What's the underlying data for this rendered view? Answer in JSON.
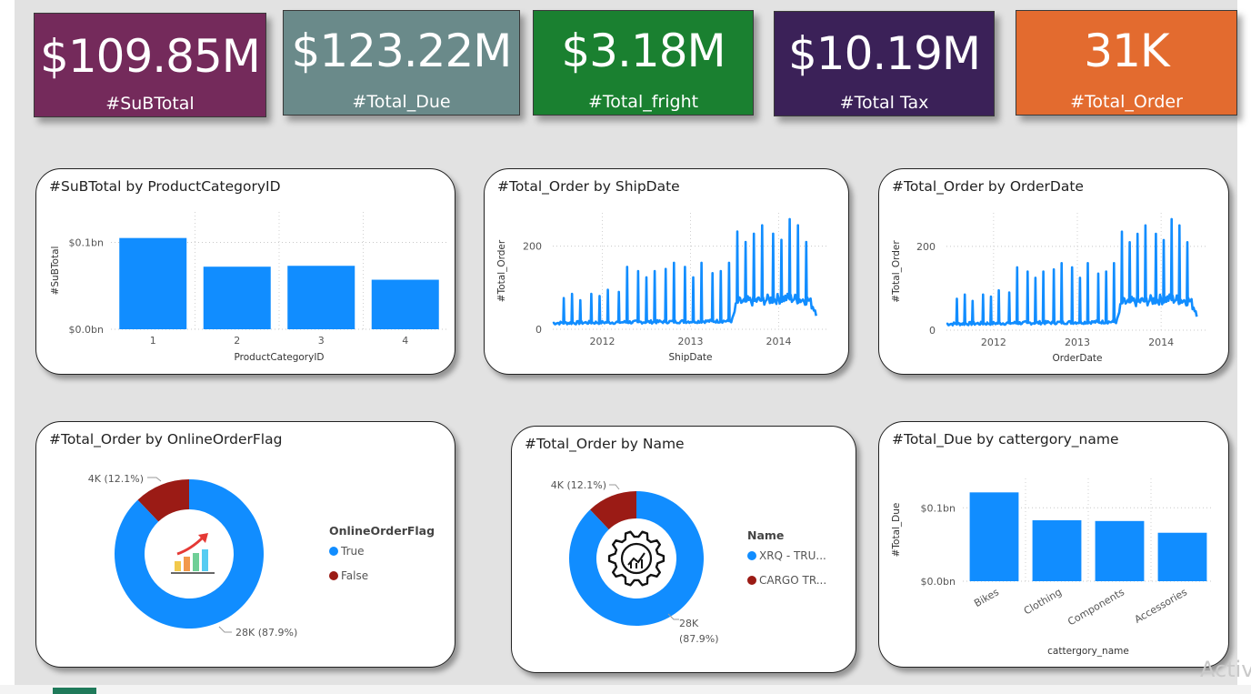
{
  "kpis": [
    {
      "value": "$109.85M",
      "label": "#SuBTotal",
      "color": "#742a5b"
    },
    {
      "value": "$123.22M",
      "label": "#Total_Due",
      "color": "#6a8a8a"
    },
    {
      "value": "$3.18M",
      "label": "#Total_fright",
      "color": "#1a8030"
    },
    {
      "value": "$10.19M",
      "label": "#Total Tax",
      "color": "#3b2158"
    },
    {
      "value": "31K",
      "label": "#Total_Order",
      "color": "#e36b2f"
    }
  ],
  "accent_color": "#118dff",
  "watermark": "Activ",
  "chart_data": [
    {
      "type": "bar",
      "title": "#SuBTotal by ProductCategoryID",
      "xlabel": "ProductCategoryID",
      "ylabel": "#SuBTotal",
      "categories": [
        "1",
        "2",
        "3",
        "4"
      ],
      "values": [
        0.105,
        0.072,
        0.073,
        0.057
      ],
      "ylim": [
        0,
        0.135
      ],
      "yticks": [
        {
          "value": 0,
          "label": "$0.0bn"
        },
        {
          "value": 0.1,
          "label": "$0.1bn"
        }
      ]
    },
    {
      "type": "line",
      "title": "#Total_Order by ShipDate",
      "xlabel": "ShipDate",
      "ylabel": "#Total_Order",
      "xticks": [
        "2012",
        "2013",
        "2014"
      ],
      "yticks": [
        0,
        200
      ],
      "ylim": [
        0,
        280
      ],
      "x_range": [
        "2011-06",
        "2014-07"
      ],
      "series": [
        {
          "baseline": [
            [
              0,
              15
            ],
            [
              0.65,
              20
            ],
            [
              0.67,
              65
            ],
            [
              0.85,
              75
            ],
            [
              0.93,
              70
            ],
            [
              0.96,
              40
            ]
          ],
          "spikes": [
            [
              0.04,
              75
            ],
            [
              0.07,
              85
            ],
            [
              0.1,
              70
            ],
            [
              0.14,
              85
            ],
            [
              0.17,
              80
            ],
            [
              0.2,
              95
            ],
            [
              0.24,
              90
            ],
            [
              0.27,
              150
            ],
            [
              0.31,
              140
            ],
            [
              0.34,
              125
            ],
            [
              0.37,
              140
            ],
            [
              0.41,
              145
            ],
            [
              0.44,
              160
            ],
            [
              0.48,
              150
            ],
            [
              0.51,
              125
            ],
            [
              0.54,
              160
            ],
            [
              0.58,
              135
            ],
            [
              0.61,
              140
            ],
            [
              0.64,
              160
            ],
            [
              0.67,
              235
            ],
            [
              0.7,
              210
            ],
            [
              0.73,
              230
            ],
            [
              0.76,
              250
            ],
            [
              0.8,
              230
            ],
            [
              0.83,
              215
            ],
            [
              0.86,
              265
            ],
            [
              0.89,
              250
            ],
            [
              0.92,
              210
            ]
          ]
        }
      ]
    },
    {
      "type": "line",
      "title": "#Total_Order by OrderDate",
      "xlabel": "OrderDate",
      "ylabel": "#Total_Order",
      "xticks": [
        "2012",
        "2013",
        "2014"
      ],
      "yticks": [
        0,
        200
      ],
      "ylim": [
        0,
        280
      ],
      "x_range": [
        "2011-06",
        "2014-07"
      ],
      "series": [
        {
          "baseline": [
            [
              0,
              15
            ],
            [
              0.65,
              20
            ],
            [
              0.67,
              65
            ],
            [
              0.85,
              75
            ],
            [
              0.93,
              70
            ],
            [
              0.96,
              40
            ]
          ],
          "spikes": [
            [
              0.04,
              75
            ],
            [
              0.07,
              85
            ],
            [
              0.1,
              70
            ],
            [
              0.14,
              85
            ],
            [
              0.17,
              80
            ],
            [
              0.2,
              95
            ],
            [
              0.24,
              90
            ],
            [
              0.27,
              150
            ],
            [
              0.31,
              140
            ],
            [
              0.34,
              125
            ],
            [
              0.37,
              140
            ],
            [
              0.41,
              145
            ],
            [
              0.44,
              160
            ],
            [
              0.48,
              150
            ],
            [
              0.51,
              125
            ],
            [
              0.54,
              160
            ],
            [
              0.58,
              135
            ],
            [
              0.61,
              140
            ],
            [
              0.64,
              160
            ],
            [
              0.67,
              235
            ],
            [
              0.7,
              210
            ],
            [
              0.73,
              230
            ],
            [
              0.76,
              250
            ],
            [
              0.8,
              230
            ],
            [
              0.83,
              215
            ],
            [
              0.86,
              265
            ],
            [
              0.89,
              250
            ],
            [
              0.92,
              210
            ]
          ]
        }
      ]
    },
    {
      "type": "pie",
      "title": "#Total_Order by OnlineOrderFlag",
      "legend_title": "OnlineOrderFlag",
      "slices": [
        {
          "name": "True",
          "value": 87.9,
          "label": "28K (87.9%)",
          "color": "#118dff"
        },
        {
          "name": "False",
          "value": 12.1,
          "label": "4K (12.1%)",
          "color": "#9b1b15"
        }
      ],
      "center_icon": "growth-chart-icon"
    },
    {
      "type": "pie",
      "title": "#Total_Order by Name",
      "legend_title": "Name",
      "slices": [
        {
          "name": "XRQ - TRU...",
          "value": 87.9,
          "label": "28K",
          "label2": "(87.9%)",
          "color": "#118dff"
        },
        {
          "name": "CARGO TR...",
          "value": 12.1,
          "label": "4K (12.1%)",
          "color": "#9b1b15"
        }
      ],
      "center_icon": "gear-chart-icon"
    },
    {
      "type": "bar",
      "title": "#Total_Due by cattergory_name",
      "xlabel": "cattergory_name",
      "ylabel": "#Total_Due",
      "categories": [
        "Bikes",
        "Clothing",
        "Components",
        "Accessories"
      ],
      "values": [
        0.121,
        0.083,
        0.082,
        0.066
      ],
      "ylim": [
        0,
        0.14
      ],
      "yticks": [
        {
          "value": 0,
          "label": "$0.0bn"
        },
        {
          "value": 0.1,
          "label": "$0.1bn"
        }
      ]
    }
  ]
}
